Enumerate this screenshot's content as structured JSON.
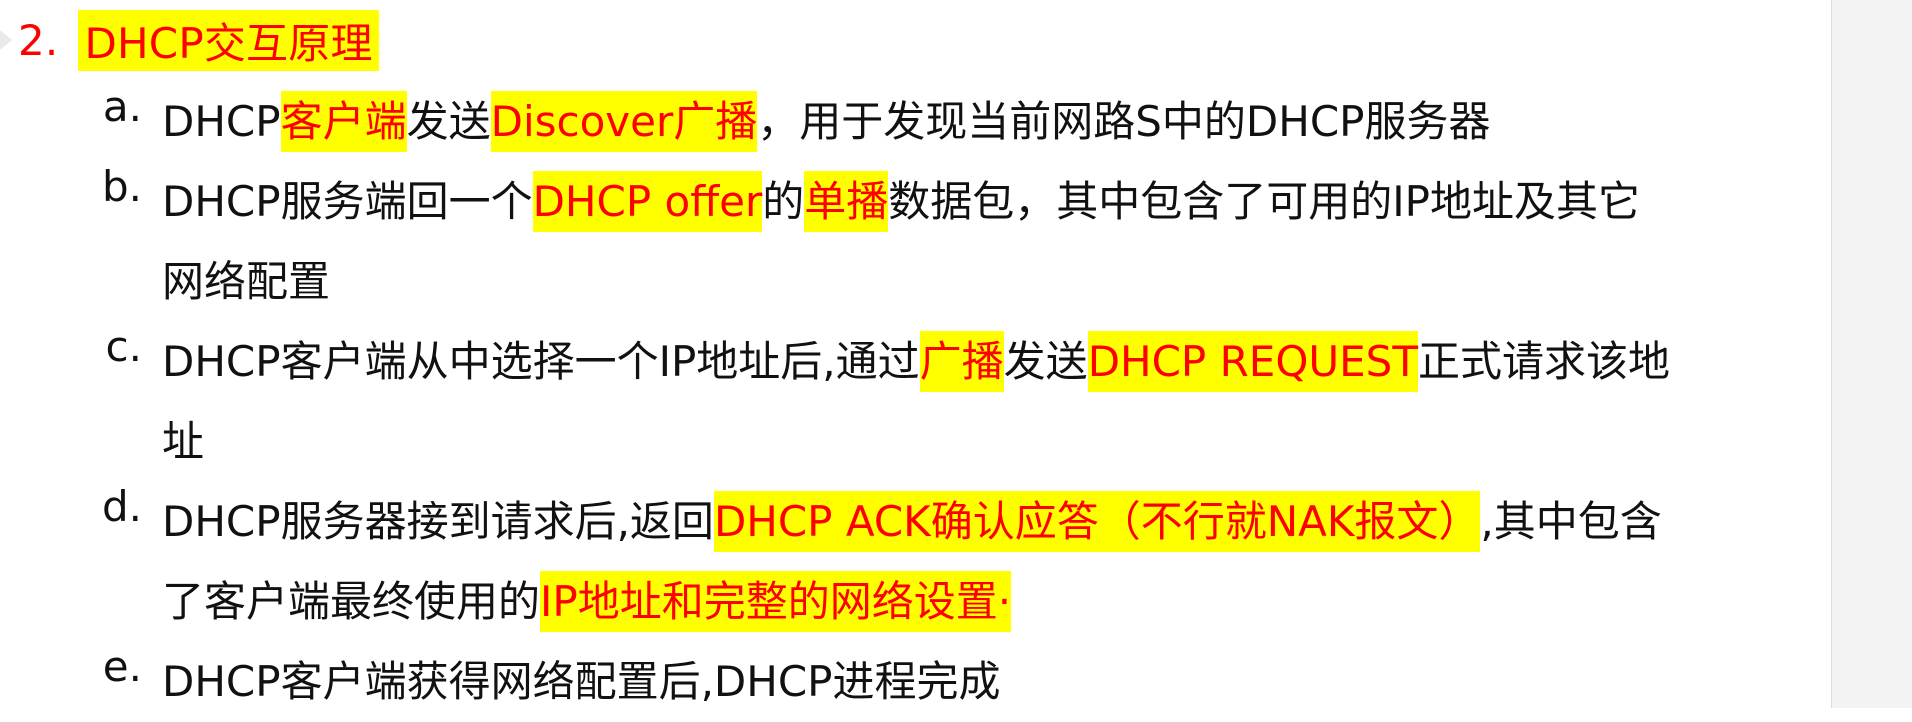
{
  "heading": {
    "number": "2.",
    "title": "DHCP交互原理"
  },
  "items": {
    "a": {
      "marker": "a.",
      "lines": [
        {
          "segments": [
            {
              "text": "DHCP",
              "hl": false
            },
            {
              "text": "客户端",
              "hl": true
            },
            {
              "text": "发送",
              "hl": false
            },
            {
              "text": "Discover广播",
              "hl": true
            },
            {
              "text": "，用于发现当前网路S中的DHCP服务器",
              "hl": false
            }
          ]
        }
      ]
    },
    "b": {
      "marker": "b.",
      "lines": [
        {
          "segments": [
            {
              "text": "DHCP服务端回一个",
              "hl": false
            },
            {
              "text": "DHCP offer",
              "hl": true
            },
            {
              "text": "的",
              "hl": false
            },
            {
              "text": "单播",
              "hl": true
            },
            {
              "text": "数据包，其中包含了可用的IP地址及其它",
              "hl": false
            }
          ]
        },
        {
          "segments": [
            {
              "text": "网络配置",
              "hl": false
            }
          ]
        }
      ]
    },
    "c": {
      "marker": "c.",
      "lines": [
        {
          "segments": [
            {
              "text": "DHCP客户端从中选择一个IP地址后,通过",
              "hl": false
            },
            {
              "text": "广播",
              "hl": true
            },
            {
              "text": "发送",
              "hl": false
            },
            {
              "text": "DHCP REQUEST",
              "hl": true
            },
            {
              "text": "正式请求该地",
              "hl": false
            }
          ]
        },
        {
          "segments": [
            {
              "text": "址",
              "hl": false
            }
          ]
        }
      ]
    },
    "d": {
      "marker": "d.",
      "lines": [
        {
          "segments": [
            {
              "text": "DHCP服务器接到请求后,返回",
              "hl": false
            },
            {
              "text": "DHCP ACK确认应答（不行就NAK报文）",
              "hl": true
            },
            {
              "text": ",其中包含",
              "hl": false
            }
          ]
        },
        {
          "segments": [
            {
              "text": "了客户端最终使用的",
              "hl": false
            },
            {
              "text": "IP地址和完整的网络设置·",
              "hl": true
            }
          ]
        }
      ]
    },
    "e": {
      "marker": "e.",
      "lines": [
        {
          "segments": [
            {
              "text": "DHCP客户端获得网络配置后,DHCP进程完成",
              "hl": false
            }
          ]
        }
      ]
    }
  },
  "colors": {
    "highlight_background": "#ffff00",
    "highlight_text": "#ff0000",
    "body_text": "#111111"
  }
}
